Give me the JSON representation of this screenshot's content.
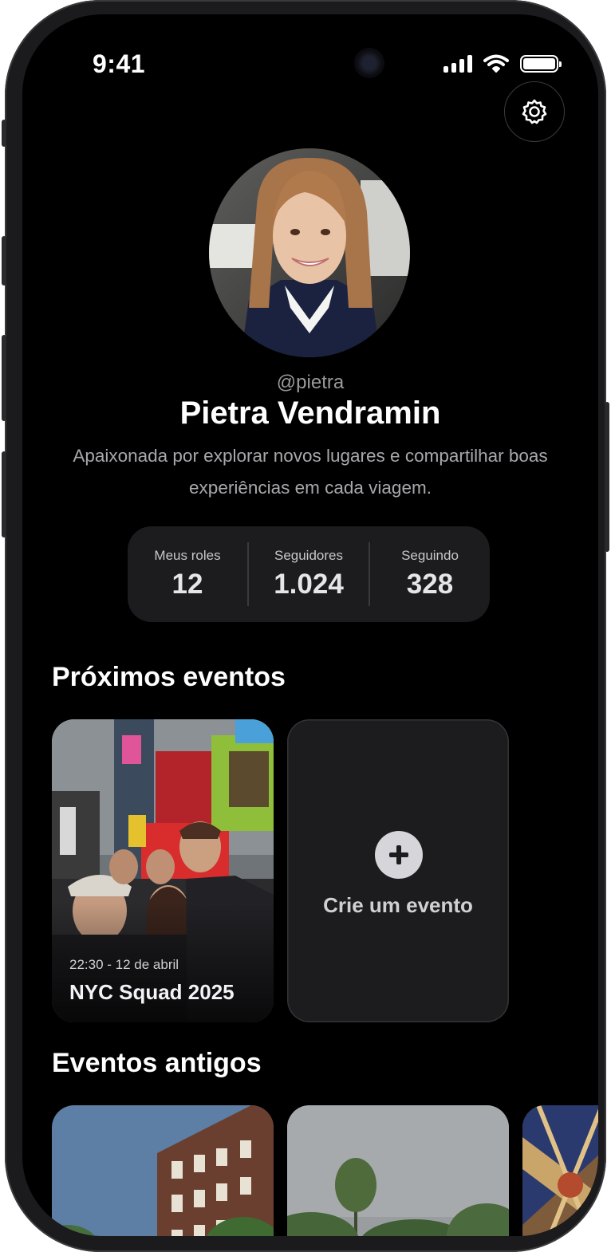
{
  "status_bar": {
    "time": "9:41"
  },
  "profile": {
    "handle": "@pietra",
    "name": "Pietra Vendramin",
    "bio": "Apaixonada por explorar novos lugares e compartilhar boas experiências em cada viagem."
  },
  "stats": [
    {
      "label": "Meus roles",
      "value": "12"
    },
    {
      "label": "Seguidores",
      "value": "1.024"
    },
    {
      "label": "Seguindo",
      "value": "328"
    }
  ],
  "upcoming": {
    "title": "Próximos eventos",
    "event": {
      "date": "22:30 - 12 de abril",
      "title": "NYC Squad 2025"
    },
    "create_label": "Crie um evento"
  },
  "past": {
    "title": "Eventos antigos"
  },
  "icons": {
    "settings": "gear-icon",
    "add": "plus-icon",
    "signal": "cellular-signal-icon",
    "wifi": "wifi-icon",
    "battery": "battery-icon"
  },
  "colors": {
    "background": "#000000",
    "card": "#1c1c1e",
    "muted_text": "#a8a8ac"
  }
}
